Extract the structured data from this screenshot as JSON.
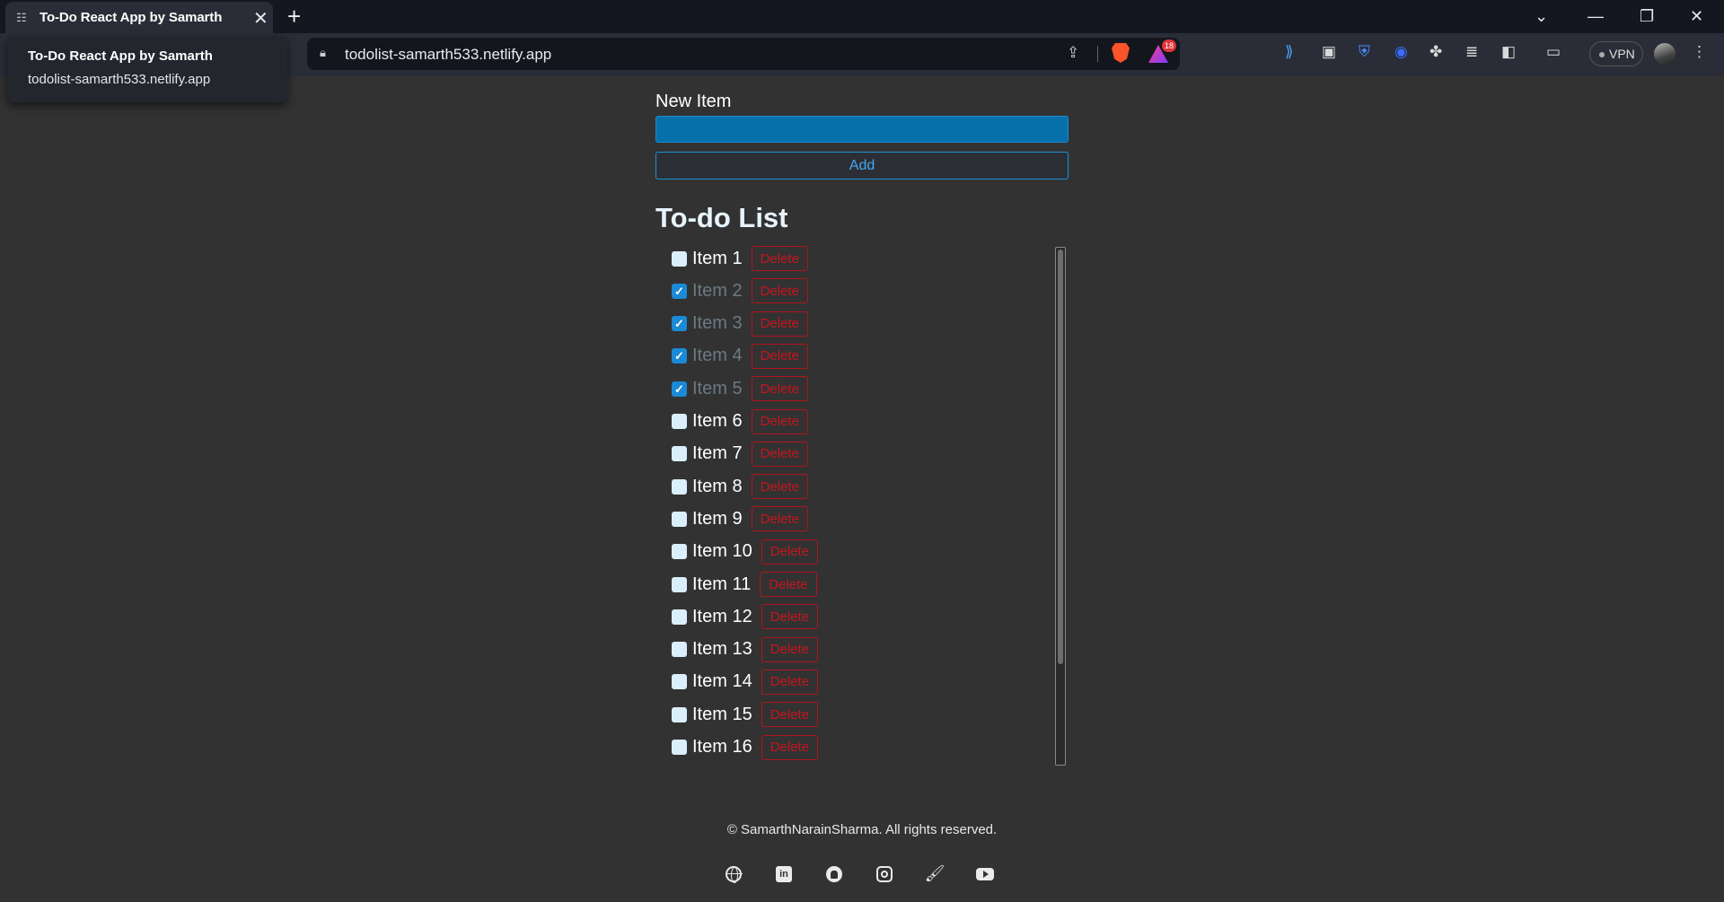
{
  "browser": {
    "tab_title": "To-Do React App by Samarth",
    "url": "todolist-samarth533.netlify.app",
    "shields_badge": "18",
    "vpn_label": "VPN",
    "new_tab_symbol": "+",
    "tab_close_symbol": "✕"
  },
  "hovercard": {
    "title": "To-Do React App by Samarth",
    "url": "todolist-samarth533.netlify.app"
  },
  "form": {
    "label": "New Item",
    "input_value": "",
    "add_label": "Add"
  },
  "list": {
    "title": "To-do List",
    "delete_label": "Delete",
    "items": [
      {
        "text": "Item 1",
        "checked": false
      },
      {
        "text": "Item 2",
        "checked": true
      },
      {
        "text": "Item 3",
        "checked": true
      },
      {
        "text": "Item 4",
        "checked": true
      },
      {
        "text": "Item 5",
        "checked": true
      },
      {
        "text": "Item 6",
        "checked": false
      },
      {
        "text": "Item 7",
        "checked": false
      },
      {
        "text": "Item 8",
        "checked": false
      },
      {
        "text": "Item 9",
        "checked": false
      },
      {
        "text": "Item 10",
        "checked": false
      },
      {
        "text": "Item 11",
        "checked": false
      },
      {
        "text": "Item 12",
        "checked": false
      },
      {
        "text": "Item 13",
        "checked": false
      },
      {
        "text": "Item 14",
        "checked": false
      },
      {
        "text": "Item 15",
        "checked": false
      },
      {
        "text": "Item 16",
        "checked": false
      }
    ]
  },
  "footer": {
    "copyright": "© SamarthNarainSharma. All rights reserved.",
    "social_icons": [
      "globe-icon",
      "linkedin-icon",
      "github-icon",
      "instagram-icon",
      "brush-icon",
      "youtube-icon"
    ]
  },
  "colors": {
    "page_bg": "#323232",
    "input_bg": "#0770ab",
    "accent_blue": "#1e8fd6",
    "delete_red": "#c4161f",
    "title_color": "#e7f4fb"
  }
}
